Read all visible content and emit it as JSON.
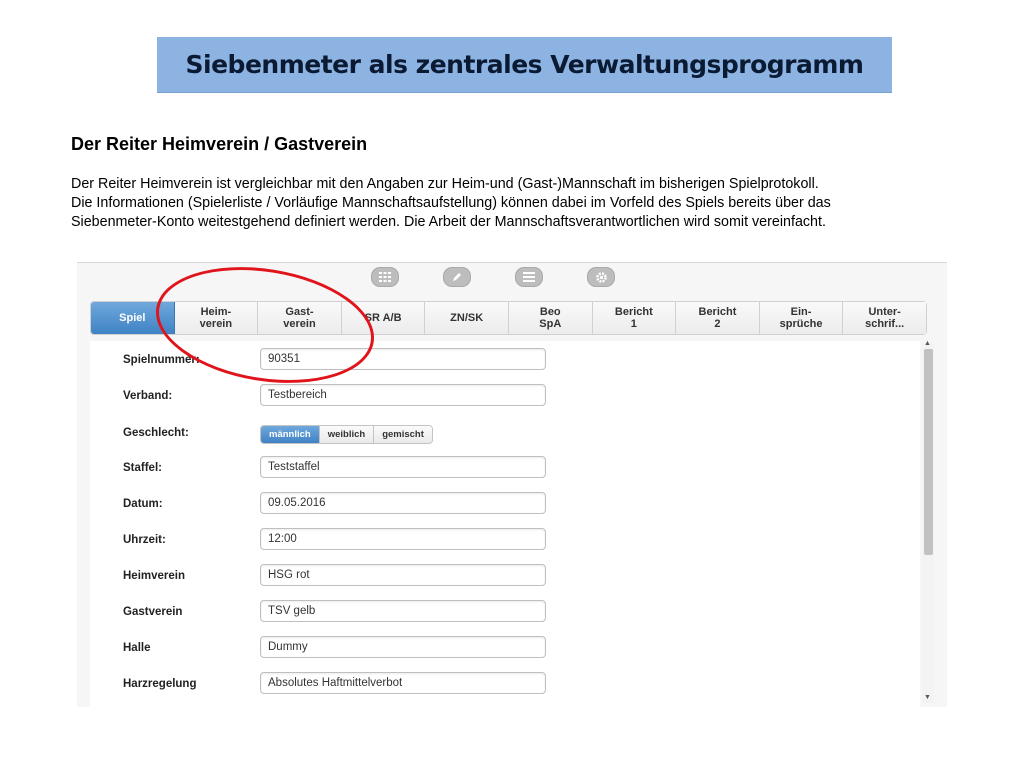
{
  "slide": {
    "title": "Siebenmeter als zentrales Verwaltungsprogramm",
    "heading": "Der Reiter Heimverein / Gastverein",
    "description_lines": [
      "Der Reiter Heimverein ist vergleichbar mit den Angaben zur Heim-und (Gast-)Mannschaft im bisherigen Spielprotokoll.",
      "Die Informationen (Spielerliste / Vorläufige Mannschaftsaufstellung) können dabei im Vorfeld des Spiels bereits über das",
      "Siebenmeter-Konto weitestgehend definiert werden. Die Arbeit der Mannschaftsverantwortlichen wird somit vereinfacht."
    ],
    "highlight_color": "#e0141b"
  },
  "toolbar": {
    "icons": [
      "grid-icon",
      "pencil-icon",
      "list-icon",
      "gear-icon"
    ]
  },
  "tabs": [
    {
      "line1": "Spiel",
      "line2": "",
      "active": true
    },
    {
      "line1": "Heim-",
      "line2": "verein",
      "active": false
    },
    {
      "line1": "Gast-",
      "line2": "verein",
      "active": false
    },
    {
      "line1": "SR A/B",
      "line2": "",
      "active": false
    },
    {
      "line1": "ZN/SK",
      "line2": "",
      "active": false
    },
    {
      "line1": "Beo",
      "line2": "SpA",
      "active": false
    },
    {
      "line1": "Bericht",
      "line2": "1",
      "active": false
    },
    {
      "line1": "Bericht",
      "line2": "2",
      "active": false
    },
    {
      "line1": "Ein-",
      "line2": "sprüche",
      "active": false
    },
    {
      "line1": "Unter-",
      "line2": "schrif...",
      "active": false
    }
  ],
  "form": {
    "spielnummer": {
      "label": "Spielnummer:",
      "value": "90351"
    },
    "verband": {
      "label": "Verband:",
      "value": "Testbereich"
    },
    "geschlecht": {
      "label": "Geschlecht:",
      "options": [
        "männlich",
        "weiblich",
        "gemischt"
      ],
      "selected": "männlich"
    },
    "staffel": {
      "label": "Staffel:",
      "value": "Teststaffel"
    },
    "datum": {
      "label": "Datum:",
      "value": "09.05.2016"
    },
    "uhrzeit": {
      "label": "Uhrzeit:",
      "value": "12:00"
    },
    "heimverein": {
      "label": "Heimverein",
      "value": "HSG rot"
    },
    "gastverein": {
      "label": "Gastverein",
      "value": "TSV gelb"
    },
    "halle": {
      "label": "Halle",
      "value": "Dummy"
    },
    "harzregelung": {
      "label": "Harzregelung",
      "value": "Absolutes Haftmittelverbot"
    }
  },
  "colors": {
    "banner": "#8db3e2",
    "active_tab": "#3f82c4"
  }
}
